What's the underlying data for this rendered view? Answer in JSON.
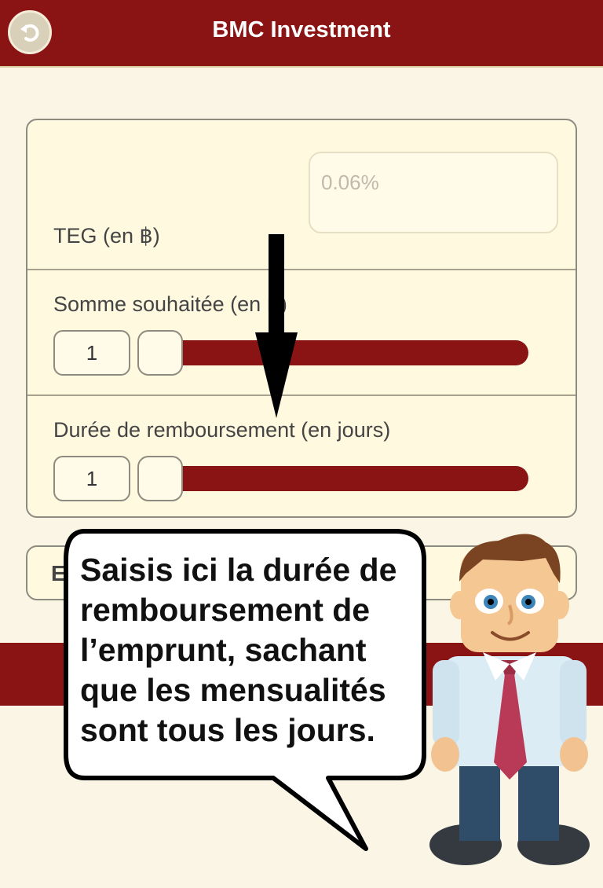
{
  "header": {
    "title": "BMC Investment",
    "back_icon": "undo-arrow-icon"
  },
  "form": {
    "teg": {
      "label": "TEG (en ฿)",
      "value": "0.06%"
    },
    "amount": {
      "label": "Somme souhaitée (en ฿)",
      "value": "1"
    },
    "duration": {
      "label": "Durée de remboursement (en jours)",
      "value": "1"
    }
  },
  "second_card": {
    "label_visible": "E"
  },
  "tutorial": {
    "bubble_text": "Saisis ici la durée de\nremboursement de\nl’emprunt, sachant\nque les mensualités\nsont tous les jours."
  },
  "colors": {
    "brand": "#8a1414",
    "background": "#fbf5e6",
    "card": "#fff9e0"
  }
}
